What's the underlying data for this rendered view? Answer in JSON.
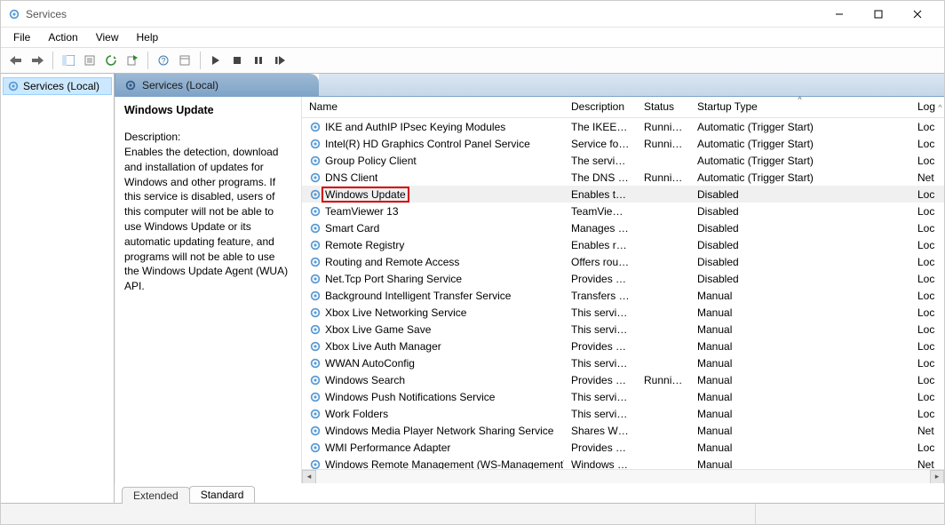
{
  "title": "Services",
  "menubar": {
    "file": "File",
    "action": "Action",
    "view": "View",
    "help": "Help"
  },
  "tree": {
    "root": "Services (Local)"
  },
  "detail": {
    "header": "Services (Local)",
    "selected_name": "Windows Update",
    "desc_label": "Description:",
    "desc_text": "Enables the detection, download and installation of updates for Windows and other programs. If this service is disabled, users of this computer will not be able to use Windows Update or its automatic updating feature, and programs will not be able to use the Windows Update Agent (WUA) API."
  },
  "columns": {
    "name": "Name",
    "desc": "Description",
    "status": "Status",
    "stype": "Startup Type",
    "log": "Log"
  },
  "sort_indicator": "^",
  "services": [
    {
      "name": "IKE and AuthIP IPsec Keying Modules",
      "desc": "The IKEEXT ...",
      "status": "Running",
      "stype": "Automatic (Trigger Start)",
      "log": "Loc"
    },
    {
      "name": "Intel(R) HD Graphics Control Panel Service",
      "desc": "Service for I...",
      "status": "Running",
      "stype": "Automatic (Trigger Start)",
      "log": "Loc"
    },
    {
      "name": "Group Policy Client",
      "desc": "The service ...",
      "status": "",
      "stype": "Automatic (Trigger Start)",
      "log": "Loc"
    },
    {
      "name": "DNS Client",
      "desc": "The DNS Cli...",
      "status": "Running",
      "stype": "Automatic (Trigger Start)",
      "log": "Net"
    },
    {
      "name": "Windows Update",
      "desc": "Enables the ...",
      "status": "",
      "stype": "Disabled",
      "log": "Loc",
      "highlight": true,
      "selected": true
    },
    {
      "name": "TeamViewer 13",
      "desc": "TeamViewer...",
      "status": "",
      "stype": "Disabled",
      "log": "Loc"
    },
    {
      "name": "Smart Card",
      "desc": "Manages ac...",
      "status": "",
      "stype": "Disabled",
      "log": "Loc"
    },
    {
      "name": "Remote Registry",
      "desc": "Enables rem...",
      "status": "",
      "stype": "Disabled",
      "log": "Loc"
    },
    {
      "name": "Routing and Remote Access",
      "desc": "Offers routi...",
      "status": "",
      "stype": "Disabled",
      "log": "Loc"
    },
    {
      "name": "Net.Tcp Port Sharing Service",
      "desc": "Provides abi...",
      "status": "",
      "stype": "Disabled",
      "log": "Loc"
    },
    {
      "name": "Background Intelligent Transfer Service",
      "desc": "Transfers fil...",
      "status": "",
      "stype": "Manual",
      "log": "Loc"
    },
    {
      "name": "Xbox Live Networking Service",
      "desc": "This service ...",
      "status": "",
      "stype": "Manual",
      "log": "Loc"
    },
    {
      "name": "Xbox Live Game Save",
      "desc": "This service ...",
      "status": "",
      "stype": "Manual",
      "log": "Loc"
    },
    {
      "name": "Xbox Live Auth Manager",
      "desc": "Provides au...",
      "status": "",
      "stype": "Manual",
      "log": "Loc"
    },
    {
      "name": "WWAN AutoConfig",
      "desc": "This service ...",
      "status": "",
      "stype": "Manual",
      "log": "Loc"
    },
    {
      "name": "Windows Search",
      "desc": "Provides co...",
      "status": "Running",
      "stype": "Manual",
      "log": "Loc"
    },
    {
      "name": "Windows Push Notifications Service",
      "desc": "This service ...",
      "status": "",
      "stype": "Manual",
      "log": "Loc"
    },
    {
      "name": "Work Folders",
      "desc": "This service ...",
      "status": "",
      "stype": "Manual",
      "log": "Loc"
    },
    {
      "name": "Windows Media Player Network Sharing Service",
      "desc": "Shares Win...",
      "status": "",
      "stype": "Manual",
      "log": "Net"
    },
    {
      "name": "WMI Performance Adapter",
      "desc": "Provides pe...",
      "status": "",
      "stype": "Manual",
      "log": "Loc"
    },
    {
      "name": "Windows Remote Management (WS-Management)",
      "desc": "Windows R...",
      "status": "",
      "stype": "Manual",
      "log": "Net"
    }
  ],
  "tabs": {
    "extended": "Extended",
    "standard": "Standard"
  }
}
